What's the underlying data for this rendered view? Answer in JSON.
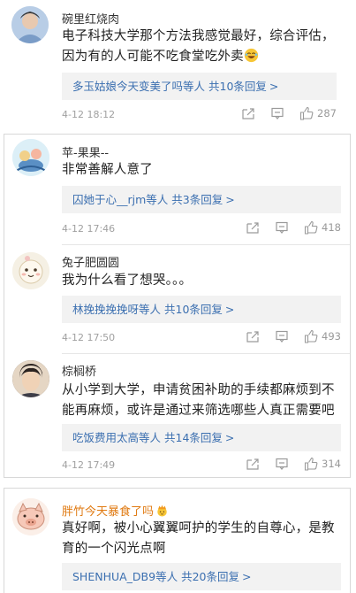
{
  "comments": [
    {
      "nickname": "碗里红烧肉",
      "text": "电子科技大学那个方法我感觉最好，综合评估，因为有的人可能不吃食堂吃外卖",
      "reply_users": "多玉姑娘今天变美了吗等人",
      "reply_count": "共10条回复",
      "time": "4-12 18:12",
      "likes": "287"
    },
    {
      "nickname": "苹-果果--",
      "text": "非常善解人意了",
      "reply_users": "囚她于心__rjm等人",
      "reply_count": "共3条回复",
      "time": "4-12 17:46",
      "likes": "418"
    },
    {
      "nickname": "兔子肥圆圆",
      "text": "我为什么看了想哭。。。",
      "reply_users": "林挽挽挽挽呀等人",
      "reply_count": "共10条回复",
      "time": "4-12 17:50",
      "likes": "493"
    },
    {
      "nickname": "棕榈桥",
      "text": "从小学到大学，申请贫困补助的手续都麻烦到不能再麻烦，或许是通过来筛选哪些人真正需要吧",
      "reply_users": "吃饭费用太高等人",
      "reply_count": "共14条回复",
      "time": "4-12 17:49",
      "likes": "314"
    },
    {
      "nickname": "胖竹今天暴食了吗",
      "text": "真好啊，被小心翼翼呵护的学生的自尊心，是教育的一个闪光点啊",
      "reply_users": "SHENHUA_DB9等人",
      "reply_count": "共20条回复"
    }
  ],
  "reply_arrow": ">",
  "icons": [
    "share-icon",
    "comment-icon",
    "like-icon",
    "laugh-emoji-icon",
    "crown-emoji-icon"
  ],
  "colors": {
    "link": "#3b6fb0",
    "vip_name": "#e07a12",
    "meta": "#a0a0a0",
    "reply_bg": "#f2f2f2"
  }
}
